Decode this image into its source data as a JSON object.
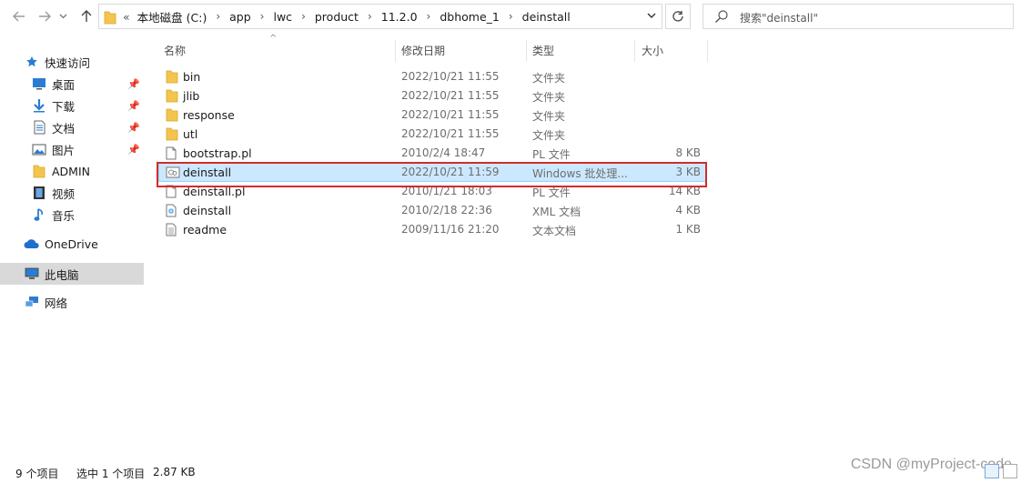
{
  "toolbar": {
    "back_icon": "arrow-left-icon",
    "forward_icon": "arrow-right-icon",
    "recent_icon": "chevron-down-icon",
    "up_icon": "arrow-up-icon",
    "breadcrumb_overflow": "«",
    "breadcrumb": [
      "本地磁盘 (C:)",
      "app",
      "lwc",
      "product",
      "11.2.0",
      "dbhome_1",
      "deinstall"
    ],
    "search_placeholder": "搜索\"deinstall\""
  },
  "sidebar": {
    "items": [
      {
        "label": "快速访问",
        "icon": "star-icon",
        "pinned": false
      },
      {
        "label": "桌面",
        "icon": "desktop-icon",
        "pinned": true
      },
      {
        "label": "下载",
        "icon": "download-icon",
        "pinned": true
      },
      {
        "label": "文档",
        "icon": "document-icon",
        "pinned": true
      },
      {
        "label": "图片",
        "icon": "picture-icon",
        "pinned": true
      },
      {
        "label": "ADMIN",
        "icon": "folder-icon",
        "pinned": false
      },
      {
        "label": "视频",
        "icon": "video-icon",
        "pinned": false
      },
      {
        "label": "音乐",
        "icon": "music-icon",
        "pinned": false
      },
      {
        "label": "OneDrive",
        "icon": "cloud-icon",
        "pinned": false
      },
      {
        "label": "此电脑",
        "icon": "computer-icon",
        "pinned": false
      },
      {
        "label": "网络",
        "icon": "network-icon",
        "pinned": false
      }
    ]
  },
  "columns": {
    "name": "名称",
    "date": "修改日期",
    "type": "类型",
    "size": "大小"
  },
  "files": [
    {
      "name": "bin",
      "date": "2022/10/21 11:55",
      "type": "文件夹",
      "size": "",
      "icon": "folder-icon"
    },
    {
      "name": "jlib",
      "date": "2022/10/21 11:55",
      "type": "文件夹",
      "size": "",
      "icon": "folder-icon"
    },
    {
      "name": "response",
      "date": "2022/10/21 11:55",
      "type": "文件夹",
      "size": "",
      "icon": "folder-icon"
    },
    {
      "name": "utl",
      "date": "2022/10/21 11:55",
      "type": "文件夹",
      "size": "",
      "icon": "folder-icon"
    },
    {
      "name": "bootstrap.pl",
      "date": "2010/2/4 18:47",
      "type": "PL 文件",
      "size": "8 KB",
      "icon": "file-icon"
    },
    {
      "name": "deinstall",
      "date": "2022/10/21 11:59",
      "type": "Windows 批处理...",
      "size": "3 KB",
      "icon": "batch-file-icon",
      "selected": true
    },
    {
      "name": "deinstall.pl",
      "date": "2010/1/21 18:03",
      "type": "PL 文件",
      "size": "14 KB",
      "icon": "file-icon"
    },
    {
      "name": "deinstall",
      "date": "2010/2/18 22:36",
      "type": "XML 文档",
      "size": "4 KB",
      "icon": "xml-file-icon"
    },
    {
      "name": "readme",
      "date": "2009/11/16 21:20",
      "type": "文本文档",
      "size": "1 KB",
      "icon": "text-file-icon"
    }
  ],
  "status": {
    "item_count": "9 个项目",
    "selection": "选中 1 个项目",
    "selection_size": "2.87 KB"
  },
  "watermark": "CSDN @myProject-code",
  "colors": {
    "selection_bg": "#cce8ff",
    "selection_border": "#99d1ff",
    "highlight_box": "#d42b2b",
    "folder": "#f4c44e"
  }
}
